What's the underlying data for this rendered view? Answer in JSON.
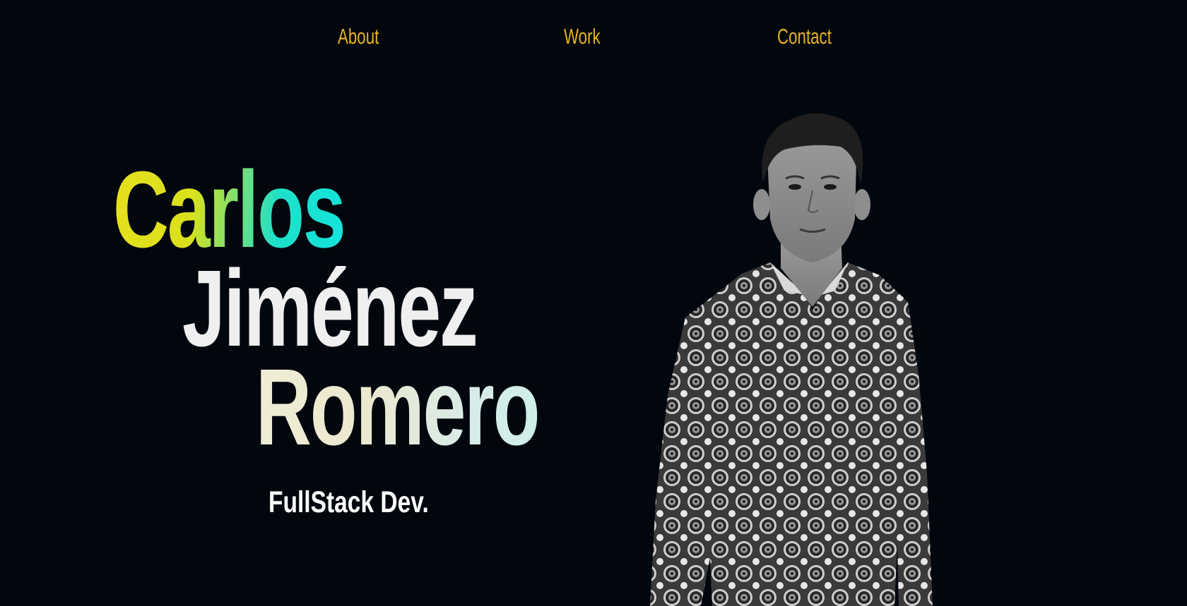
{
  "nav": {
    "items": [
      {
        "label": "About"
      },
      {
        "label": "Work"
      },
      {
        "label": "Contact"
      }
    ],
    "color": "#e8b21c"
  },
  "hero": {
    "first_name": "Carlos",
    "middle_name": "Jiménez",
    "last_name": "Romero",
    "role": "FullStack Dev."
  },
  "portrait": {
    "style": "grayscale-photo",
    "icon": "person-photo"
  },
  "colors": {
    "background": "#02070e",
    "accent": "#e8b21c",
    "gradient_start": "#e7df1e",
    "gradient_end": "#12e4dc"
  }
}
